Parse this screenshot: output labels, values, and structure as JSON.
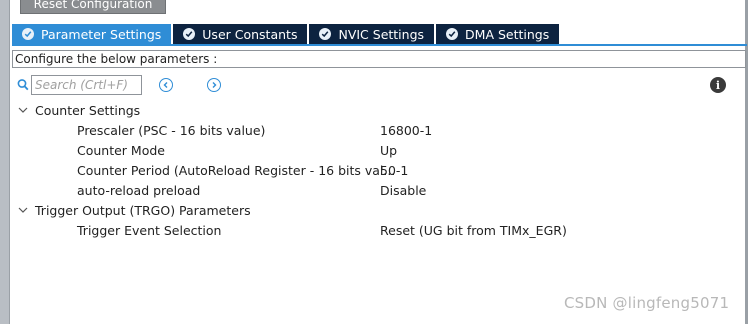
{
  "toolbar": {
    "reset_label": "Reset Configuration"
  },
  "tabs": [
    {
      "label": "Parameter Settings",
      "active": true
    },
    {
      "label": "User Constants",
      "active": false
    },
    {
      "label": "NVIC Settings",
      "active": false
    },
    {
      "label": "DMA Settings",
      "active": false
    }
  ],
  "configure_text": "Configure the below parameters :",
  "search": {
    "placeholder": "Search (Crtl+F)"
  },
  "icons": {
    "search": "search-icon",
    "prev": "chevron-left-icon",
    "next": "chevron-right-icon",
    "info": "info-icon",
    "check": "check-circle-icon",
    "collapse": "chevron-down-icon"
  },
  "colors": {
    "active_tab": "#2f8dd6",
    "inactive_tab": "#0d2340",
    "reset_button": "#8a8d90"
  },
  "groups": [
    {
      "label": "Counter Settings",
      "params": [
        {
          "name": "Prescaler (PSC - 16 bits value)",
          "value": "16800-1"
        },
        {
          "name": "Counter Mode",
          "value": "Up"
        },
        {
          "name": "Counter Period (AutoReload Register - 16 bits val...",
          "value": "50-1"
        },
        {
          "name": "auto-reload preload",
          "value": "Disable"
        }
      ]
    },
    {
      "label": "Trigger Output (TRGO) Parameters",
      "params": [
        {
          "name": "Trigger Event Selection",
          "value": "Reset (UG bit from TIMx_EGR)"
        }
      ]
    }
  ],
  "watermark": "CSDN @lingfeng5071"
}
